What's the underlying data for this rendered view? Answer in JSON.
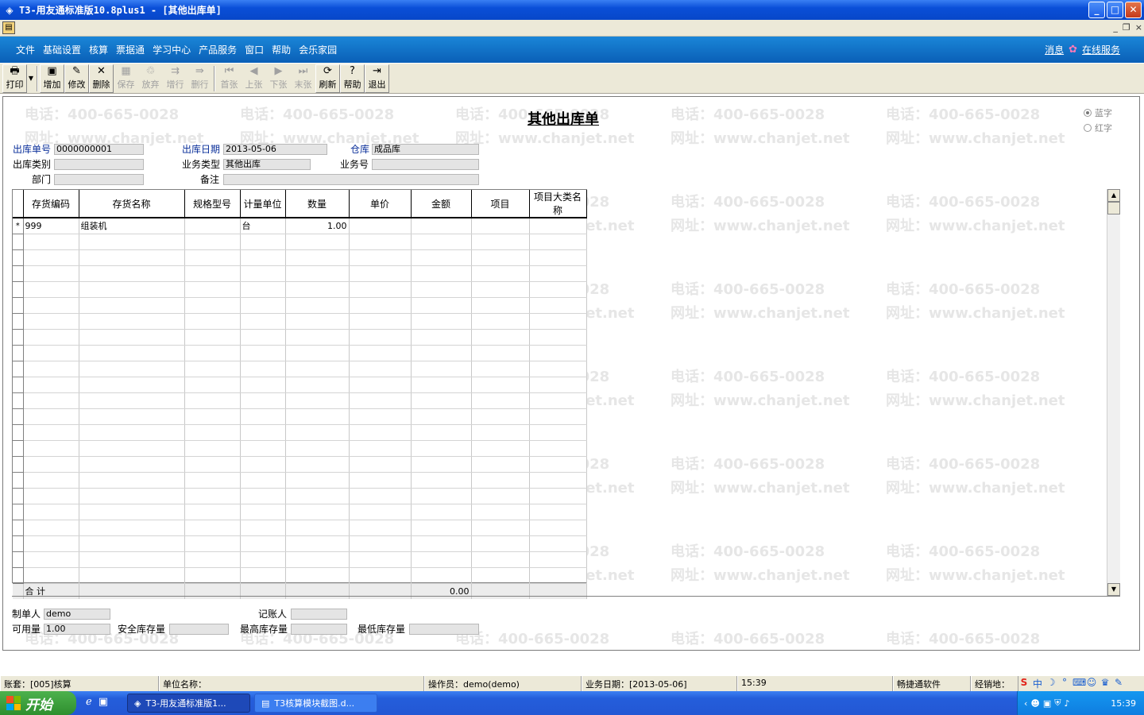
{
  "window": {
    "title": "T3-用友通标准版10.8plus1 - [其他出库单]",
    "app_icon": "yonyou-icon",
    "min": "_",
    "max": "□",
    "close": "✕"
  },
  "mdi": {
    "min": "_",
    "restore": "❐",
    "close": "×"
  },
  "menu": {
    "items": [
      "文件",
      "基础设置",
      "核算",
      "票据通",
      "学习中心",
      "产品服务",
      "窗口",
      "帮助",
      "会乐家园"
    ],
    "messages": "消息",
    "online_service": "在线服务"
  },
  "toolbar": {
    "print": "打印",
    "add": "增加",
    "edit": "修改",
    "delete": "删除",
    "save": "保存",
    "discard": "放弃",
    "add_row": "增行",
    "del_row": "删行",
    "first": "首张",
    "prev": "上张",
    "next": "下张",
    "last": "末张",
    "refresh": "刷新",
    "help": "帮助",
    "exit": "退出"
  },
  "form": {
    "title": "其他出库单",
    "blue_label": "蓝字",
    "red_label": "红字",
    "selected_color": "蓝字",
    "out_no_label": "出库单号",
    "out_no": "0000000001",
    "out_date_label": "出库日期",
    "out_date": "2013-05-06",
    "warehouse_label": "仓库",
    "warehouse": "成品库",
    "out_type_label": "出库类别",
    "out_type": "",
    "biz_type_label": "业务类型",
    "biz_type": "其他出库",
    "biz_no_label": "业务号",
    "biz_no": "",
    "dept_label": "部门",
    "dept": "",
    "remark_label": "备注",
    "remark": ""
  },
  "grid": {
    "columns": [
      "存货编码",
      "存货名称",
      "规格型号",
      "计量单位",
      "数量",
      "单价",
      "金额",
      "项目",
      "项目大类名称"
    ],
    "rows": [
      {
        "marker": "*",
        "code": "999",
        "name": "组装机",
        "spec": "",
        "unit": "台",
        "qty": "1.00",
        "price": "",
        "amount": "",
        "project": "",
        "category": ""
      }
    ],
    "total_label": "合  计",
    "total_amount": "0.00"
  },
  "footer": {
    "maker_label": "制单人",
    "maker": "demo",
    "bookkeeper_label": "记账人",
    "bookkeeper": "",
    "available_label": "可用量",
    "available": "1.00",
    "safety_label": "安全库存量",
    "safety": "",
    "max_label": "最高库存量",
    "max": "",
    "min_label": "最低库存量",
    "min": ""
  },
  "watermark": {
    "phone": "电话：400-665-0028",
    "site": "网址：www.chanjet.net"
  },
  "statusbar": {
    "account": "账套：[005]核算",
    "company": "单位名称：",
    "operator": "操作员：demo(demo)",
    "biz_date": "业务日期：[2013-05-06]",
    "time": "15:39",
    "vendor": "畅捷通软件",
    "dealer": "经销地："
  },
  "taskbar": {
    "start": "开始",
    "tasks": [
      "T3-用友通标准版1...",
      "T3核算模块截图.d..."
    ],
    "clock": "15:39"
  }
}
